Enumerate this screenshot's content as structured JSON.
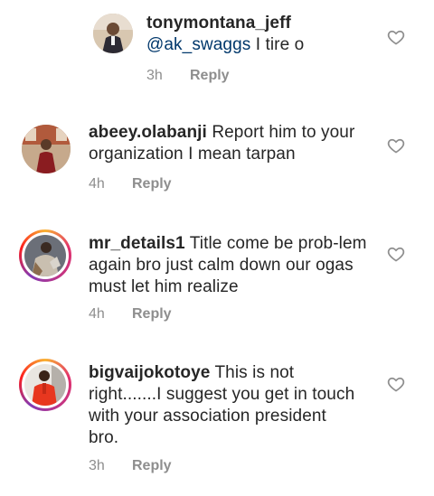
{
  "comments": [
    {
      "username": "tonymontana_jeff",
      "mention": "@ak_swaggs",
      "text": " I tire o",
      "time": "3h",
      "reply": "Reply",
      "avatar_icon": "user-avatar"
    },
    {
      "username": "abeey.olabanji",
      "text": " Report him to your  organization I mean tarpan",
      "time": "4h",
      "reply": "Reply",
      "avatar_icon": "user-avatar"
    },
    {
      "username": "mr_details1",
      "text": " Title come  be prob-lem again bro just calm down our ogas must let him realize",
      "time": "4h",
      "reply": "Reply",
      "avatar_icon": "user-avatar-story-ring"
    },
    {
      "username": "bigvaijokotoye",
      "text": " This is not right.......I suggest you get in touch with your association president bro.",
      "time": "3h",
      "reply": "Reply",
      "avatar_icon": "user-avatar-story-ring"
    }
  ],
  "colors": {
    "text": "#262626",
    "meta": "#8e8e8e",
    "mention": "#00376b",
    "heart_outline": "#8e8e8e"
  },
  "icons": {
    "like": "heart-outline-icon"
  }
}
